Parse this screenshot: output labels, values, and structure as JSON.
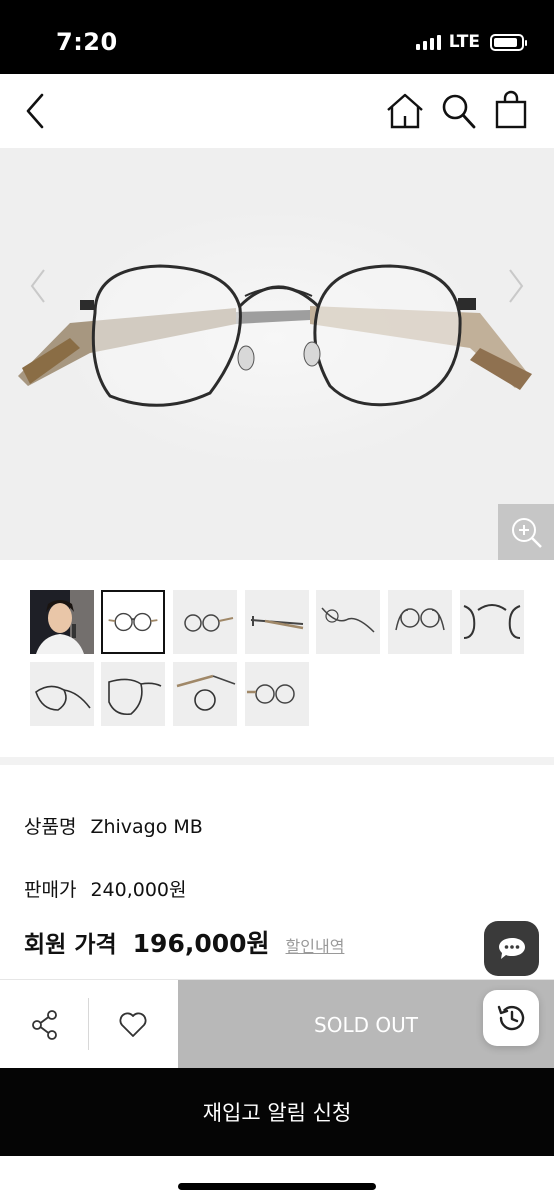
{
  "status_bar": {
    "time": "7:20",
    "network": "LTE",
    "signal_bars": 4,
    "battery_level": 0.9
  },
  "nav": {
    "back_icon": "chevron-left-icon",
    "home_icon": "home-icon",
    "search_icon": "search-icon",
    "cart_icon": "shopping-bag-icon"
  },
  "gallery": {
    "prev_icon": "chevron-left-icon",
    "next_icon": "chevron-right-icon",
    "zoom_icon": "zoom-in-icon",
    "selected_thumbnail": 1,
    "thumbnail_count": 11
  },
  "product": {
    "name_label": "상품명",
    "name": "Zhivago MB",
    "price_label": "판매가",
    "price": "240,000원",
    "member_price_label": "회원 가격",
    "member_price": "196,000원",
    "discount_link": "할인내역"
  },
  "actions": {
    "share_icon": "share-icon",
    "wishlist_icon": "heart-icon",
    "sold_out": "SOLD OUT",
    "restock_alert": "재입고 알림 신청"
  },
  "floating": {
    "chat_icon": "chat-bubble-icon",
    "recent_icon": "history-icon"
  },
  "colors": {
    "sold_out_bg": "#b8b8b8",
    "restock_bg": "#050505",
    "chat_fab_bg": "#3a3a3a"
  }
}
